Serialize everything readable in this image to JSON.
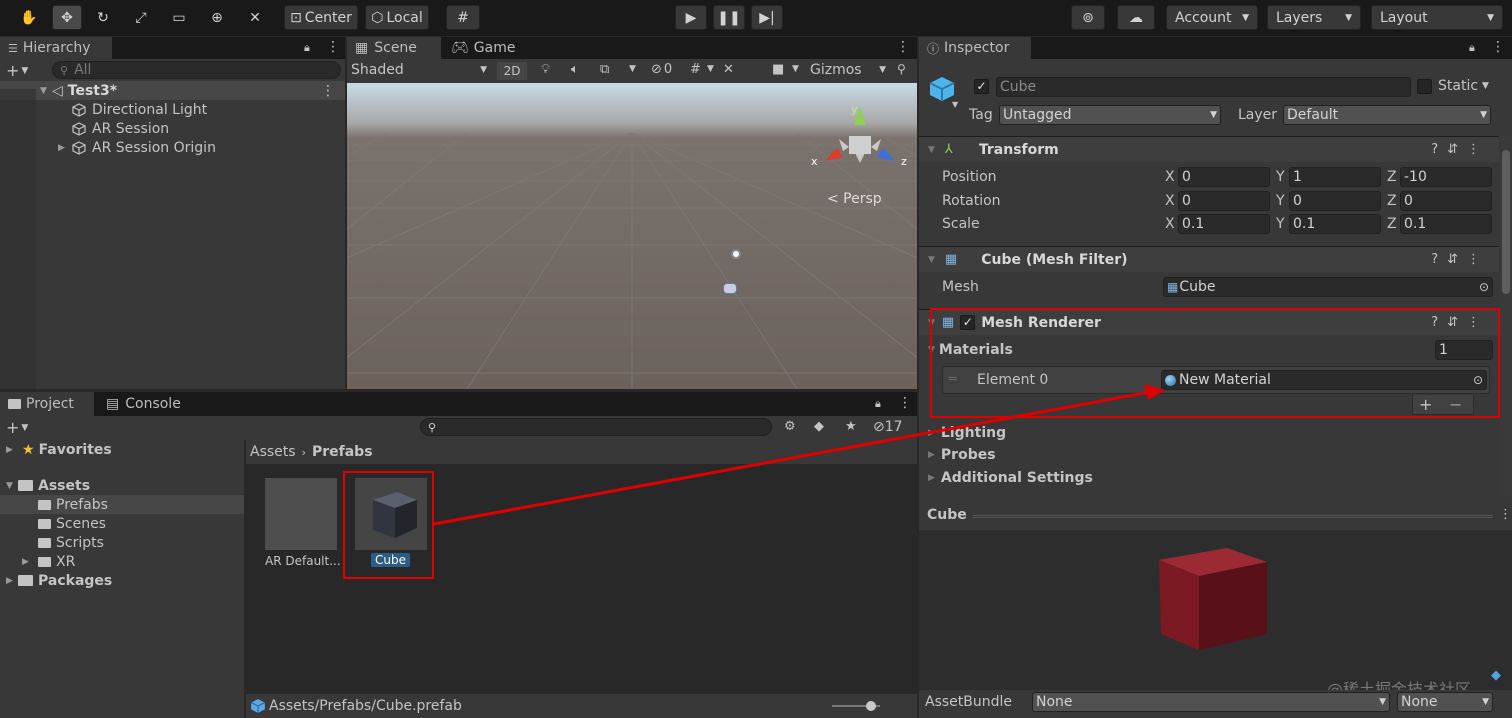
{
  "toolbar": {
    "center_label": "Center",
    "local_label": "Local",
    "account_label": "Account",
    "layers_label": "Layers",
    "layout_label": "Layout"
  },
  "hierarchy": {
    "tab": "Hierarchy",
    "search_placeholder": "All",
    "scene_name": "Test3*",
    "items": [
      "Directional Light",
      "AR Session",
      "AR Session Origin"
    ]
  },
  "scene": {
    "tab_scene": "Scene",
    "tab_game": "Game",
    "shading": "Shaded",
    "mode_2d": "2D",
    "hidden_count": "0",
    "gizmos": "Gizmos",
    "persp": "< Persp",
    "axis_x": "x",
    "axis_y": "y",
    "axis_z": "z"
  },
  "project": {
    "tab_project": "Project",
    "tab_console": "Console",
    "hidden_count": "17",
    "favorites": "Favorites",
    "assets": "Assets",
    "asset_folders": [
      "Prefabs",
      "Scenes",
      "Scripts",
      "XR"
    ],
    "packages": "Packages",
    "breadcrumb_root": "Assets",
    "breadcrumb_current": "Prefabs",
    "grid_items": [
      "AR Default...",
      "Cube"
    ],
    "status_path": "Assets/Prefabs/Cube.prefab"
  },
  "inspector": {
    "tab": "Inspector",
    "object_name": "Cube",
    "static_label": "Static",
    "tag_label": "Tag",
    "tag_value": "Untagged",
    "layer_label": "Layer",
    "layer_value": "Default",
    "transform": {
      "title": "Transform",
      "rows": [
        {
          "label": "Position",
          "x": "0",
          "y": "1",
          "z": "-10"
        },
        {
          "label": "Rotation",
          "x": "0",
          "y": "0",
          "z": "0"
        },
        {
          "label": "Scale",
          "x": "0.1",
          "y": "0.1",
          "z": "0.1"
        }
      ],
      "axis_x": "X",
      "axis_y": "Y",
      "axis_z": "Z"
    },
    "mesh_filter": {
      "title": "Cube (Mesh Filter)",
      "mesh_label": "Mesh",
      "mesh_value": "Cube"
    },
    "mesh_renderer": {
      "title": "Mesh Renderer",
      "materials_label": "Materials",
      "materials_count": "1",
      "element_label": "Element 0",
      "element_value": "New Material",
      "add": "+",
      "remove": "−"
    },
    "foldouts": [
      "Lighting",
      "Probes",
      "Additional Settings"
    ],
    "preview_title": "Cube",
    "assetbundle_label": "AssetBundle",
    "assetbundle_value": "None",
    "assetbundle_variant": "None"
  },
  "watermark": "@稀土掘金技术社区",
  "colors": {
    "highlight_red": "#e00000",
    "selection_blue": "#2c5d87",
    "preview_cube": "#8b1d26"
  }
}
